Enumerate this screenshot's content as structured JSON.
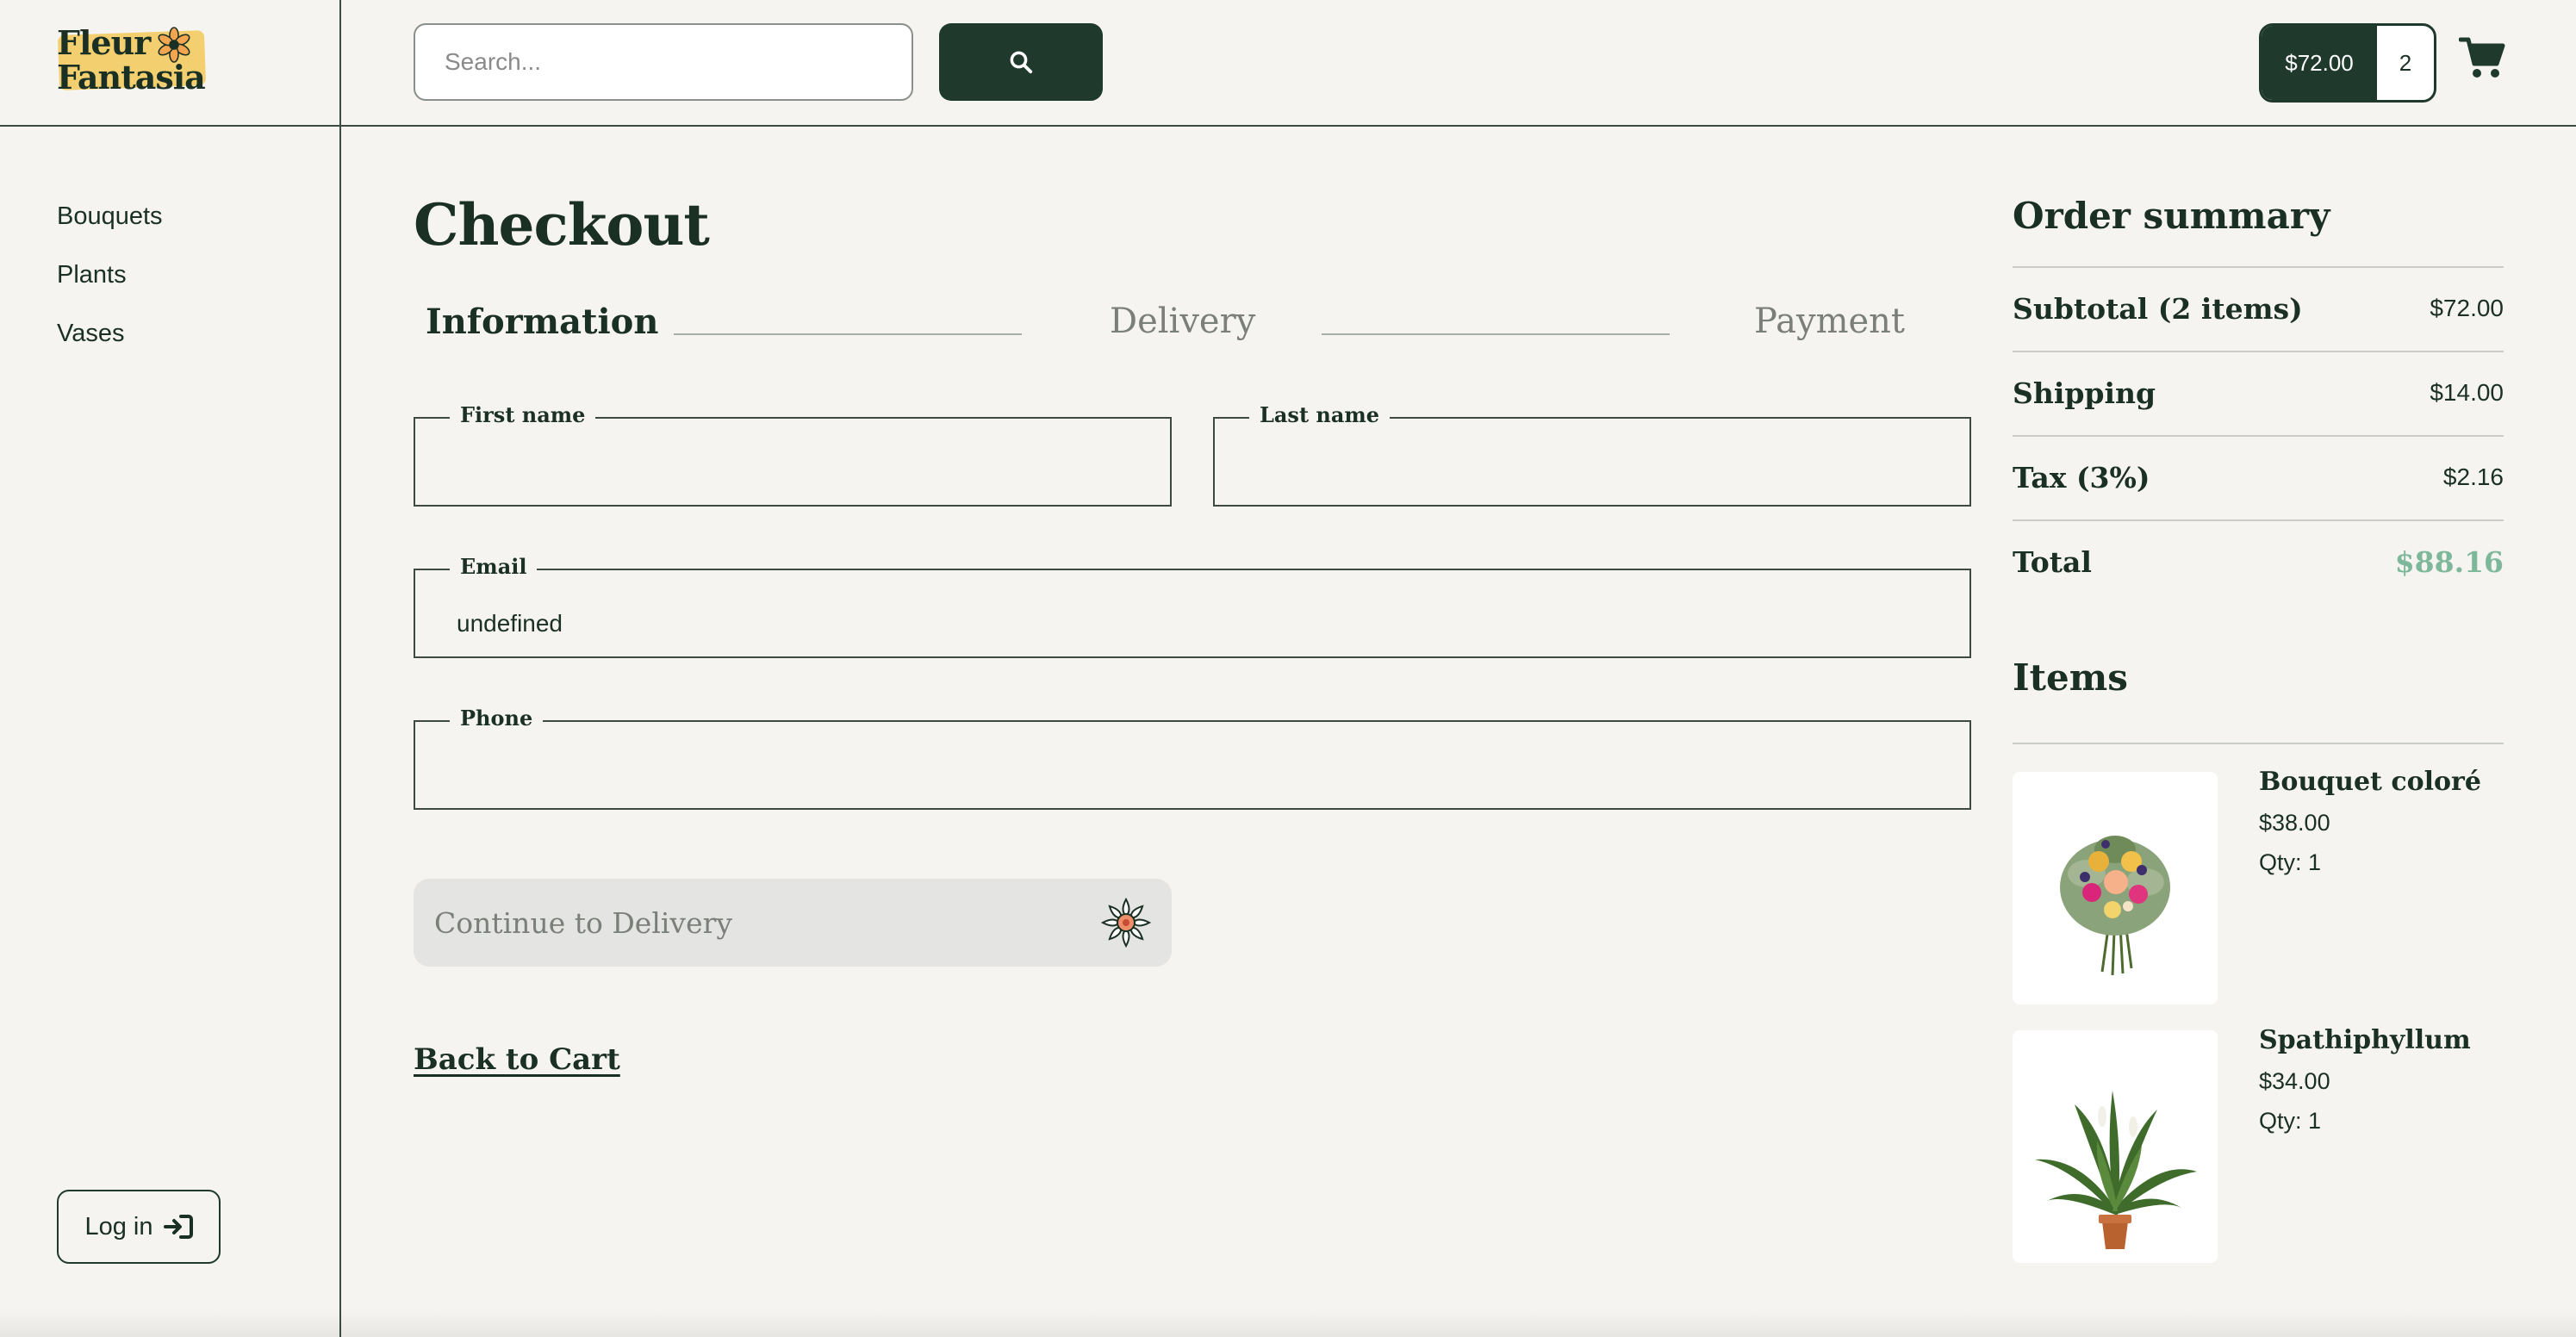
{
  "brand": {
    "logo_text": "Fleur\nFantasia",
    "logo_color": "#f3cf6f"
  },
  "search": {
    "placeholder": "Search..."
  },
  "cart": {
    "total": "$72.00",
    "count": "2"
  },
  "sidebar": {
    "items": [
      {
        "label": "Bouquets"
      },
      {
        "label": "Plants"
      },
      {
        "label": "Vases"
      }
    ],
    "login_label": "Log in"
  },
  "checkout": {
    "title": "Checkout",
    "steps": [
      {
        "label": "Information",
        "state": "active"
      },
      {
        "label": "Delivery",
        "state": "inactive"
      },
      {
        "label": "Payment",
        "state": "inactive"
      }
    ],
    "fields": {
      "first_name": {
        "label": "First name",
        "value": ""
      },
      "last_name": {
        "label": "Last name",
        "value": ""
      },
      "email": {
        "label": "Email",
        "value": "undefined"
      },
      "phone": {
        "label": "Phone",
        "value": ""
      }
    },
    "continue_label": "Continue to Delivery",
    "back_label": "Back to Cart"
  },
  "summary": {
    "title": "Order summary",
    "rows": [
      {
        "label": "Subtotal (2 items)",
        "value": "$72.00"
      },
      {
        "label": "Shipping",
        "value": "$14.00"
      },
      {
        "label": "Tax (3%)",
        "value": "$2.16"
      },
      {
        "label": "Total",
        "value": "$88.16"
      }
    ],
    "items_title": "Items",
    "items": [
      {
        "name": "Bouquet coloré",
        "price": "$38.00",
        "qty": "Qty: 1"
      },
      {
        "name": "Spathiphyllum",
        "price": "$34.00",
        "qty": "Qty: 1"
      }
    ]
  },
  "colors": {
    "background": "#f6f4f0",
    "primary": "#1f3a2d",
    "total_accent": "#7eb89b",
    "disabled_button": "#e4e4e2"
  }
}
